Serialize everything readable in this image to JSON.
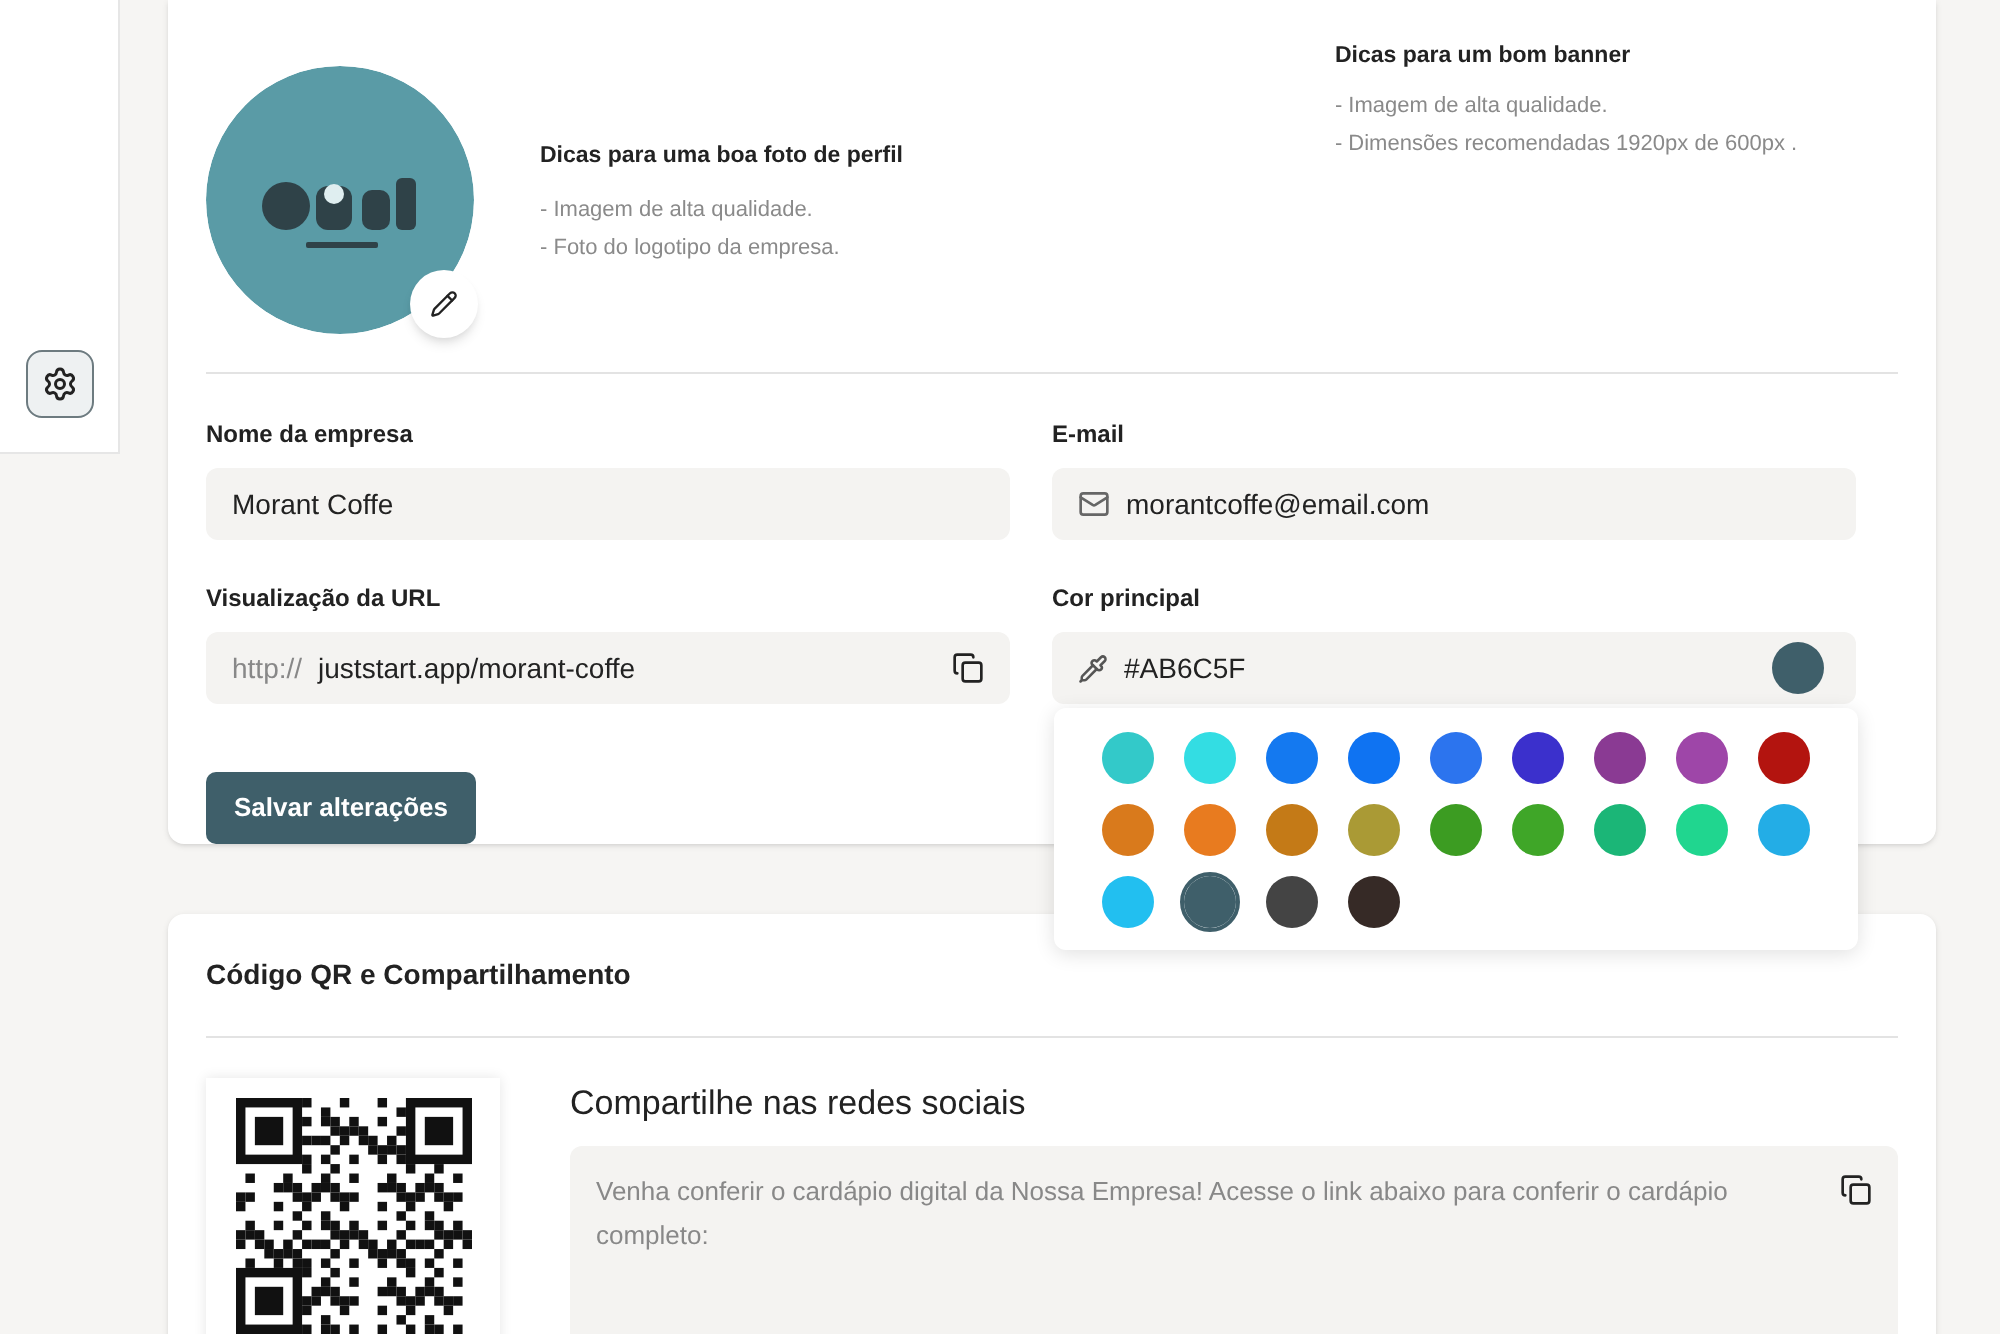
{
  "sidebar": {
    "items": [
      {
        "kind": "settings",
        "selected": false
      }
    ]
  },
  "profile": {
    "photo_tips": {
      "title": "Dicas para uma boa foto de perfil",
      "lines": [
        "- Imagem de alta qualidade.",
        "- Foto do logotipo da empresa."
      ]
    },
    "banner_tips": {
      "title": "Dicas para um bom banner",
      "lines": [
        "- Imagem de alta qualidade.",
        "- Dimensões recomendadas 1920px de 600px ."
      ]
    }
  },
  "form": {
    "company_name": {
      "label": "Nome da empresa",
      "value": "Morant Coffe"
    },
    "email": {
      "label": "E-mail",
      "value": "morantcoffe@email.com"
    },
    "url": {
      "label": "Visualização da URL",
      "prefix": "http://",
      "value": "juststart.app/morant-coffe"
    },
    "main_color": {
      "label": "Cor principal",
      "value": "#AB6C5F",
      "color": "#3f5f6a"
    },
    "save_button": "Salvar alterações"
  },
  "palette": [
    {
      "color": "#33c9c9",
      "selected": false
    },
    {
      "color": "#33dde3",
      "selected": false
    },
    {
      "color": "#1479f0",
      "selected": false
    },
    {
      "color": "#0f73f2",
      "selected": false
    },
    {
      "color": "#2c74ee",
      "selected": false
    },
    {
      "color": "#3b30cc",
      "selected": false
    },
    {
      "color": "#8a3a93",
      "selected": false
    },
    {
      "color": "#9e46a8",
      "selected": false
    },
    {
      "color": "#b3140f",
      "selected": false
    },
    {
      "color": "#d97a1c",
      "selected": false
    },
    {
      "color": "#e87b1f",
      "selected": false
    },
    {
      "color": "#c47a17",
      "selected": false
    },
    {
      "color": "#aa9a35",
      "selected": false
    },
    {
      "color": "#3c9c22",
      "selected": false
    },
    {
      "color": "#3fa628",
      "selected": false
    },
    {
      "color": "#1bb677",
      "selected": false
    },
    {
      "color": "#20d68f",
      "selected": false
    },
    {
      "color": "#23ade6",
      "selected": false
    },
    {
      "color": "#22bff0",
      "selected": false
    },
    {
      "color": "#3f5f6a",
      "selected": true
    },
    {
      "color": "#444444",
      "selected": false
    },
    {
      "color": "#362a26",
      "selected": false
    }
  ],
  "share": {
    "title": "Código QR e Compartilhamento",
    "subtitle": "Compartilhe nas redes sociais",
    "message": "Venha conferir o cardápio digital da Nossa Empresa! Acesse o link abaixo para conferir o cardápio completo:"
  }
}
